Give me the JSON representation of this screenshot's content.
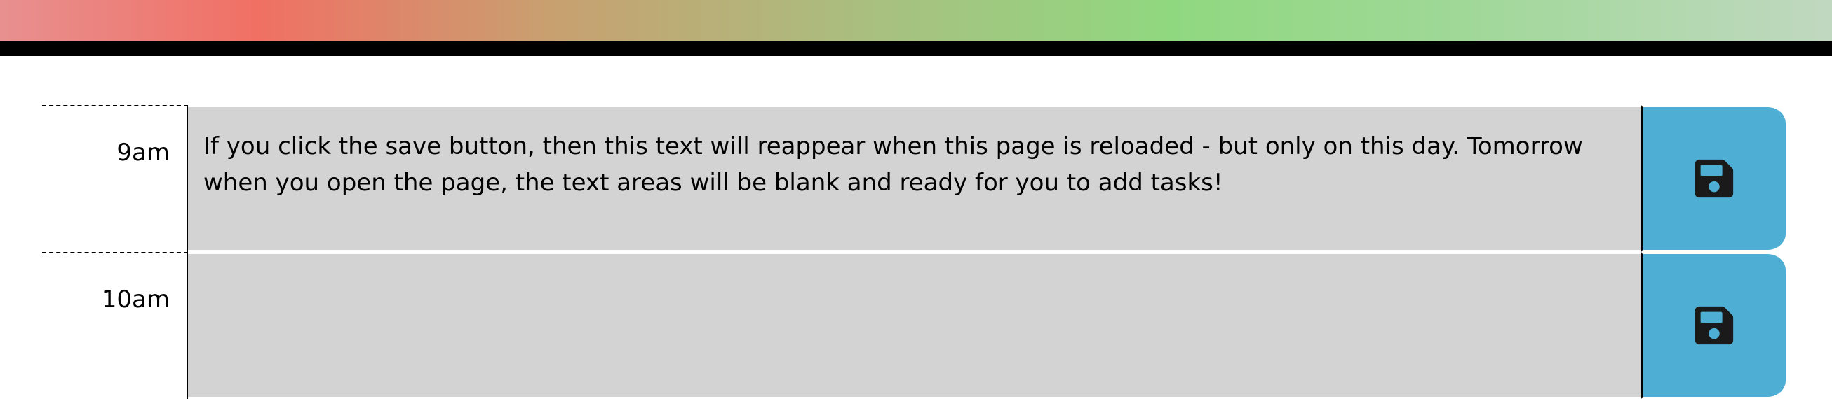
{
  "header": {
    "gradient_colors": [
      "#e89090",
      "#f07064",
      "#c8a070",
      "#90d880",
      "#b8d8b8"
    ]
  },
  "schedule": {
    "rows": [
      {
        "hour": "9am",
        "text": "If you click the save button, then this text will reappear when this page is reloaded - but only on this day. Tomorrow when you open the page, the text areas will be blank and ready for you to add tasks!",
        "save_icon": "floppy-disk-icon"
      },
      {
        "hour": "10am",
        "text": "",
        "save_icon": "floppy-disk-icon"
      }
    ]
  },
  "colors": {
    "description_bg": "#d3d3d3",
    "save_button_bg": "#4faed4",
    "icon_color": "#1a1a1a"
  }
}
